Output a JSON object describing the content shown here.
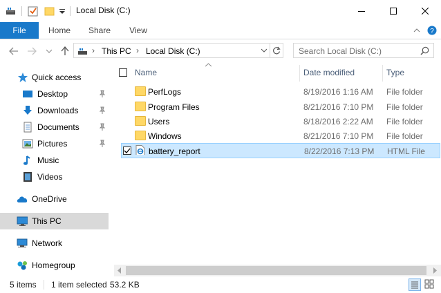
{
  "window": {
    "title": "Local Disk (C:)",
    "minimize_icon": "minimize-icon",
    "maximize_icon": "maximize-icon",
    "close_icon": "close-icon"
  },
  "ribbon": {
    "tabs": [
      {
        "label": "File"
      },
      {
        "label": "Home"
      },
      {
        "label": "Share"
      },
      {
        "label": "View"
      }
    ]
  },
  "address": {
    "segments": [
      "This PC",
      "Local Disk (C:)"
    ],
    "search_placeholder": "Search Local Disk (C:)"
  },
  "nav": {
    "quick_access": "Quick access",
    "items": [
      {
        "label": "Desktop",
        "pinned": true
      },
      {
        "label": "Downloads",
        "pinned": true
      },
      {
        "label": "Documents",
        "pinned": true
      },
      {
        "label": "Pictures",
        "pinned": true
      },
      {
        "label": "Music",
        "pinned": false
      },
      {
        "label": "Videos",
        "pinned": false
      }
    ],
    "onedrive": "OneDrive",
    "this_pc": "This PC",
    "network": "Network",
    "homegroup": "Homegroup"
  },
  "columns": {
    "name": "Name",
    "date": "Date modified",
    "type": "Type"
  },
  "files": [
    {
      "name": "PerfLogs",
      "date": "8/19/2016 1:16 AM",
      "type": "File folder",
      "kind": "folder"
    },
    {
      "name": "Program Files",
      "date": "8/21/2016 7:10 PM",
      "type": "File folder",
      "kind": "folder"
    },
    {
      "name": "Users",
      "date": "8/18/2016 2:22 AM",
      "type": "File folder",
      "kind": "folder"
    },
    {
      "name": "Windows",
      "date": "8/21/2016 7:10 PM",
      "type": "File folder",
      "kind": "folder"
    },
    {
      "name": "battery_report",
      "date": "8/22/2016 7:13 PM",
      "type": "HTML File",
      "kind": "html",
      "selected": true
    }
  ],
  "status": {
    "item_count": "5 items",
    "selection": "1 item selected",
    "size": "53.2 KB"
  },
  "colors": {
    "accent": "#1979ca",
    "selection_bg": "#cce8ff",
    "selection_border": "#99d1ff"
  }
}
